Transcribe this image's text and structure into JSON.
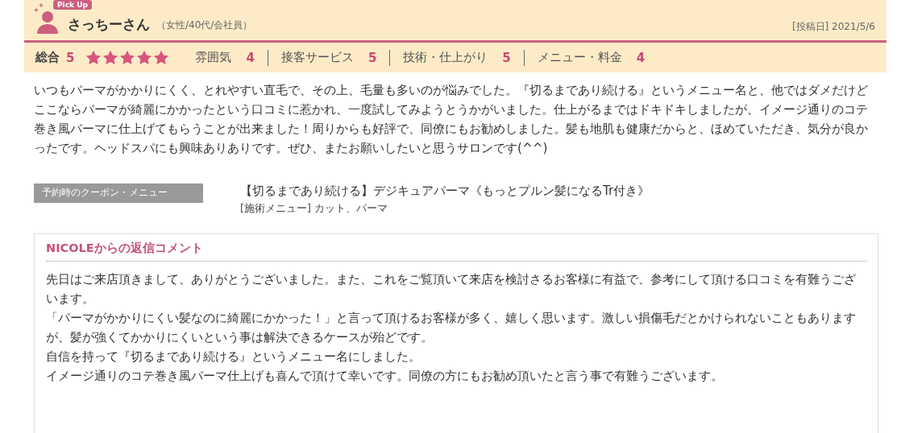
{
  "review": {
    "badge": "Pick Up",
    "name": "さっちーさん",
    "attributes": "（女性/40代/会社員）",
    "posted_label": "[投稿日]",
    "posted_date": "2021/5/6"
  },
  "overall": {
    "label": "総合",
    "score": "5",
    "stars": 5
  },
  "ratings": [
    {
      "label": "雰囲気",
      "score": "4"
    },
    {
      "label": "接客サービス",
      "score": "5"
    },
    {
      "label": "技術・仕上がり",
      "score": "5"
    },
    {
      "label": "メニュー・料金",
      "score": "4"
    }
  ],
  "body": "いつもパーマがかかりにくく、とれやすい直毛で、その上、毛量も多いのが悩みでした。『切るまであり続ける』というメニュー名と、他ではダメだけどここならパーマが綺麗にかかったという口コミに惹かれ、一度試してみようとうかがいました。仕上がるまではドキドキしましたが、イメージ通りのコテ巻き風パーマに仕上げてもらうことが出来ました！周りからも好評で、同僚にもお勧めしました。髪も地肌も健康だからと、ほめていただき、気分が良かったです。ヘッドスパにも興味ありありです。ぜひ、またお願いしたいと思うサロンです(^^)",
  "coupon": {
    "label": "予約時のクーポン・メニュー",
    "title": "【切るまであり続ける】デジキュアパーマ《もっとプルン髪になるTr付き》",
    "menu_label": "[施術メニュー]",
    "menu": "カット、パーマ"
  },
  "reply": {
    "title": "NICOLEからの返信コメント",
    "paragraphs": [
      "先日はご来店頂きまして、ありがとうございました。また、これをご覧頂いて来店を検討さるお客様に有益で、参考にして頂ける口コミを有難うございます。",
      "「パーマがかかりにくい髪なのに綺麗にかかった！」と言って頂けるお客様が多く、嬉しく思います。激しい損傷毛だとかけられないこともありますが、髪が強くてかかりにくいという事は解決できるケースが殆どです。",
      "自信を持って『切るまであり続ける』というメニュー名にしました。",
      "イメージ通りのコテ巻き風パーマ仕上げも喜んで頂けて幸いです。同僚の方にもお勧め頂いたと言う事で有難うございます。"
    ]
  }
}
